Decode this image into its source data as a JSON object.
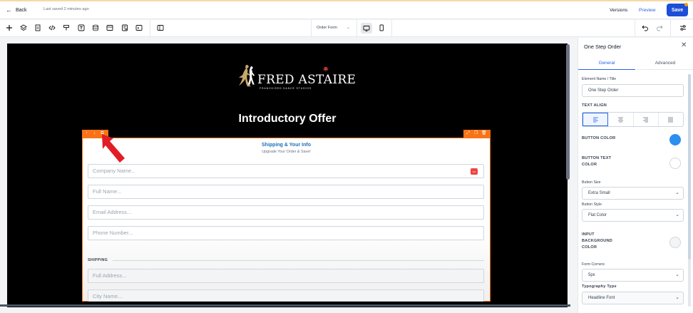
{
  "topbar": {
    "back_label": "Back",
    "last_saved": "Last saved 2 minutes ago",
    "versions_label": "Versions",
    "preview_label": "Preview",
    "save_label": "Save"
  },
  "toolbar": {
    "page_selector": "Order Form",
    "icons": [
      "plus-icon",
      "layers-icon",
      "page-icon",
      "code-icon",
      "paint-roller-icon",
      "text-icon",
      "database-icon",
      "layout-icon",
      "form-icon",
      "terminal-icon",
      "columns-icon",
      "desktop-icon",
      "mobile-icon",
      "undo-icon",
      "redo-icon",
      "settings-toggle-icon"
    ]
  },
  "canvas": {
    "brand_name": "FRED ASTAIRE",
    "brand_tagline": "FRANCHISED DANCE STUDIOS",
    "heading": "Introductory Offer",
    "form": {
      "title": "Shipping & Your Info",
      "subtitle": "Upgrade Your Order & Save!",
      "fields": [
        {
          "placeholder": "Company Name.."
        },
        {
          "placeholder": "Full Name..."
        },
        {
          "placeholder": "Email Address..."
        },
        {
          "placeholder": "Phone Number..."
        }
      ],
      "shipping_label": "SHIPPING",
      "shipping_fields": [
        {
          "placeholder": "Full Address..."
        },
        {
          "placeholder": "City Name..."
        }
      ]
    }
  },
  "panel": {
    "title": "One Step Order",
    "tabs": {
      "general": "General",
      "advanced": "Advanced"
    },
    "element_name_label": "Element Name / Title",
    "element_name_value": "One Step Order",
    "text_align_label": "TEXT ALIGN",
    "button_color_label": "BUTTON COLOR",
    "button_color": "#2b8ff0",
    "button_text_color_label": "BUTTON TEXT COLOR",
    "button_text_color": "#ffffff",
    "button_size_label": "Button Size",
    "button_size_value": "Extra Small",
    "button_style_label": "Button Style",
    "button_style_value": "Flat Color",
    "input_bg_label": "INPUT BACKGROUND COLOR",
    "input_bg_color": "#f3f4f6",
    "form_corners_label": "Form Corners",
    "form_corners_value": "5px",
    "typography_label": "Typography Type",
    "typography_value": "Headline Font"
  },
  "colors": {
    "accent": "#2563eb",
    "selection_outline": "#f97316",
    "annotation_arrow": "#e11d26"
  }
}
